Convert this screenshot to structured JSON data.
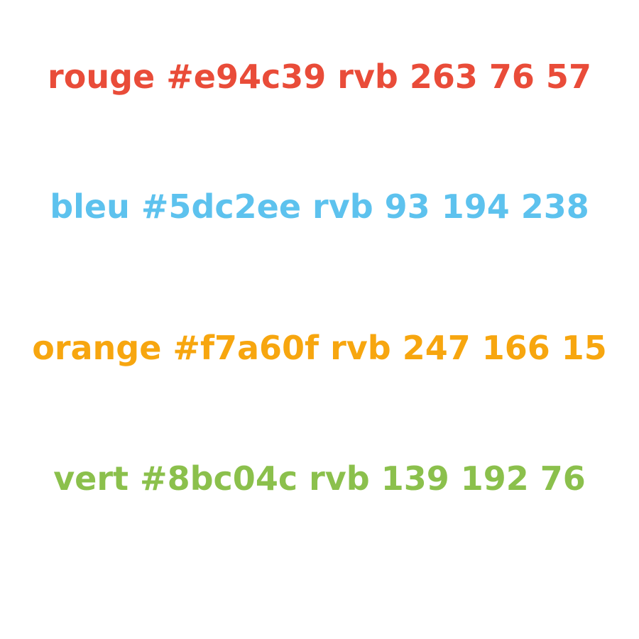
{
  "colors": [
    {
      "text": "rouge #e94c39 rvb 263 76 57",
      "hex": "#e94c39"
    },
    {
      "text": "bleu #5dc2ee rvb 93 194 238",
      "hex": "#5dc2ee"
    },
    {
      "text": "orange #f7a60f rvb 247 166 15",
      "hex": "#f7a60f"
    },
    {
      "text": "vert #8bc04c rvb 139 192 76",
      "hex": "#8bc04c"
    }
  ]
}
